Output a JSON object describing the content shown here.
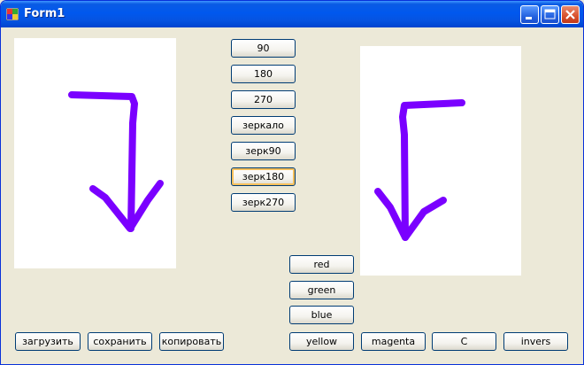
{
  "window": {
    "title": "Form1"
  },
  "rotate_buttons": [
    "90",
    "180",
    "270",
    "зеркало",
    "зерк90",
    "зерк180",
    "зерк270"
  ],
  "color_buttons": [
    "red",
    "green",
    "blue"
  ],
  "bottom_left_buttons": [
    "загрузить",
    "сохранить",
    "копировать"
  ],
  "bottom_right_buttons": [
    "yellow",
    "magenta",
    "C",
    "invers"
  ],
  "colors": {
    "stroke": "#7a00ff",
    "titlebar": "#0058ee",
    "form_background": "#ece9d8"
  },
  "focused_button": "зерк180"
}
